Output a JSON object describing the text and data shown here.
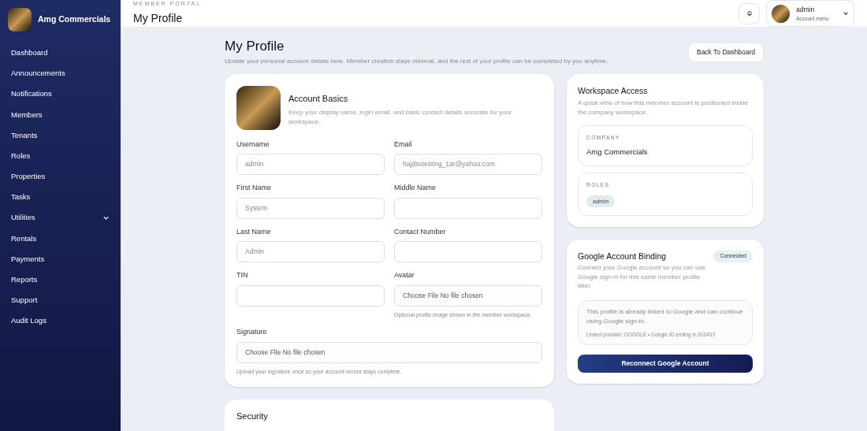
{
  "brand": {
    "name": "Amg Commercials"
  },
  "sidebar": {
    "items": [
      {
        "label": "Dashboard"
      },
      {
        "label": "Announcements"
      },
      {
        "label": "Notifications"
      },
      {
        "label": "Members"
      },
      {
        "label": "Tenants"
      },
      {
        "label": "Roles"
      },
      {
        "label": "Properties"
      },
      {
        "label": "Tasks"
      },
      {
        "label": "Utilities",
        "expanded": false
      },
      {
        "label": "Rentals"
      },
      {
        "label": "Payments"
      },
      {
        "label": "Reports"
      },
      {
        "label": "Support"
      },
      {
        "label": "Audit Logs"
      }
    ]
  },
  "header": {
    "eyebrow": "MEMBER PORTAL",
    "title": "My Profile",
    "account": {
      "name": "admin",
      "subtitle": "Account menu"
    }
  },
  "page": {
    "title": "My Profile",
    "subtitle": "Update your personal account details here. Member creation stays minimal, and the rest of your profile can be completed by you anytime.",
    "back_button": "Back To Dashboard"
  },
  "account_basics": {
    "title": "Account Basics",
    "description": "Keep your display name, login email, and basic contact details accurate for your workspace.",
    "fields": [
      {
        "label": "Username",
        "value": "admin",
        "kind": "text"
      },
      {
        "label": "Email",
        "value": "hajdsvtesting_1ar@yahoo.com",
        "kind": "text"
      },
      {
        "label": "First Name",
        "value": "System",
        "kind": "text"
      },
      {
        "label": "Middle Name",
        "kind": "text"
      },
      {
        "label": "Last Name",
        "value": "Admin",
        "kind": "text"
      },
      {
        "label": "Contact Number",
        "kind": "text"
      },
      {
        "label": "TIN",
        "kind": "text"
      },
      {
        "label": "Avatar",
        "value": "Choose File No file chosen",
        "kind": "file",
        "hint": "Optional profile image shown in the member workspace."
      },
      {
        "label": "Signature",
        "value": "Choose File No file chosen",
        "kind": "file",
        "hint": "Upload your signature once so your account record stays complete."
      }
    ]
  },
  "security": {
    "title": "Security"
  },
  "workspace_access": {
    "title": "Workspace Access",
    "description": "A quick view of how this member account is positioned inside the company workspace.",
    "company_label": "COMPANY",
    "company": "Amg Commercials",
    "roles_label": "ROLES",
    "roles": [
      "admin"
    ]
  },
  "google_binding": {
    "title": "Google Account Binding",
    "status": "Connected",
    "description": "Connect your Google account so you can use Google sign-in for this same member profile later.",
    "notice": "This profile is already linked to Google and can continue using Google sign-in.",
    "provider_line": "Linked provider: GOOGLE • Google ID ending in 610433",
    "button": "Reconnect Google Account"
  }
}
